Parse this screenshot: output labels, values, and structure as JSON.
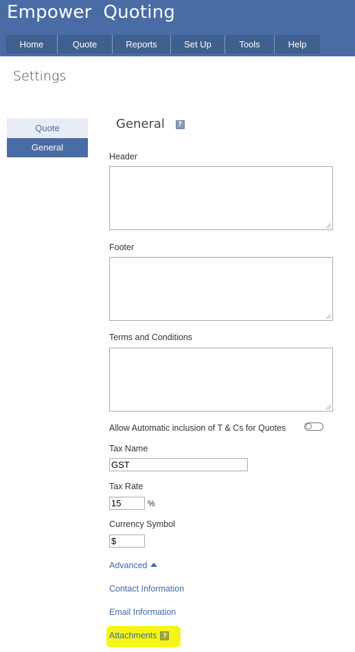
{
  "app": {
    "title": "Empower  Quoting"
  },
  "nav": [
    "Home",
    "Quote",
    "Reports",
    "Set Up",
    "Tools",
    "Help"
  ],
  "page": {
    "title": "Settings"
  },
  "sidebar": {
    "items": [
      "Quote",
      "General"
    ],
    "selected": "General"
  },
  "general": {
    "title": "General",
    "help_glyph": "?",
    "header_label": "Header",
    "header_value": "",
    "footer_label": "Footer",
    "footer_value": "",
    "terms_label": "Terms and Conditions",
    "terms_value": "",
    "auto_tc_label": "Allow Automatic inclusion of T & Cs for Quotes",
    "auto_tc_enabled": false,
    "tax_name_label": "Tax Name",
    "tax_name_value": "GST",
    "tax_rate_label": "Tax Rate",
    "tax_rate_value": "15",
    "tax_rate_unit": "%",
    "currency_label": "Currency Symbol",
    "currency_value": "$"
  },
  "links": {
    "advanced": "Advanced",
    "contact": "Contact Information",
    "email": "Email Information",
    "attachments": "Attachments"
  },
  "colors": {
    "header_bg": "#4a6ca5",
    "nav_bg": "#3f5f8f",
    "link": "#3d6aa8",
    "highlight": "#f5f51a"
  }
}
